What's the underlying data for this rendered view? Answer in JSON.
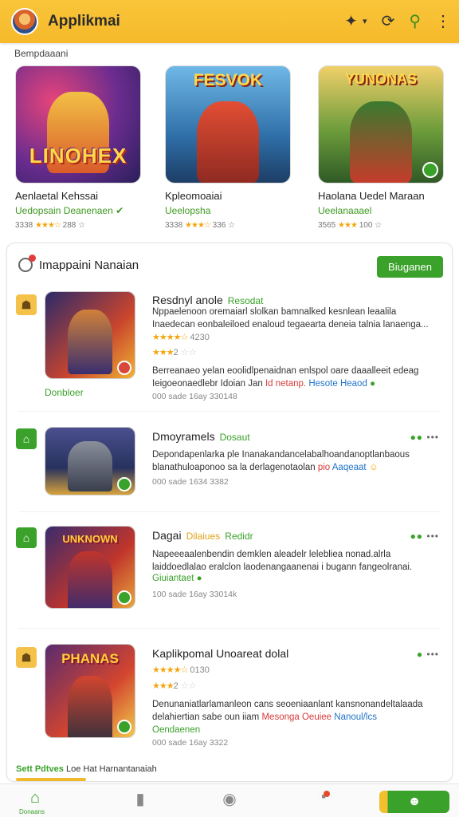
{
  "appbar": {
    "title": "Applikmai",
    "icons": [
      "bird-icon",
      "chevron-down-icon",
      "refresh-icon",
      "search-icon",
      "more-vertical-icon"
    ]
  },
  "featured": {
    "section_label": "Bempdaaani",
    "items": [
      {
        "logo_text": "LINOHEX",
        "top_text": "",
        "name": "Aenlaetal Kehssai",
        "sub": "Uedopsain Deanenaen",
        "rating": "3338",
        "rating_extra": "288",
        "colors": [
          "#3a1f6e",
          "#c63a7a",
          "#f0a623"
        ]
      },
      {
        "logo_text": "",
        "top_text": "FESVOK",
        "name": "Kpleomoaiai",
        "sub": "Ueelopsha",
        "rating": "3338",
        "rating_extra": "336",
        "colors": [
          "#2f6fa8",
          "#e24e33",
          "#f2b441"
        ]
      },
      {
        "logo_text": "",
        "top_text": "YUNONAS",
        "name": "Haolana Uedel Maraan",
        "sub": "Ueelanaaael",
        "rating": "3565",
        "rating_extra": "100",
        "colors": [
          "#3a6f2f",
          "#c53c2b",
          "#f5d24b"
        ]
      }
    ]
  },
  "panel": {
    "title": "Imappaini Nanaian",
    "button_label": "Biuganen",
    "rows": [
      {
        "title": "Resdnyl anole",
        "tag": "Resodat",
        "desc_lines": [
          "Nppaelenoon oremaiarl slolkan bamnalked kesnlean leaalila",
          "Inaedecan eonbaleiloed enaloud tegaearta deneia talnia lanaenga..."
        ],
        "rating_main": "4230",
        "rating_second": "2",
        "desc2_lines": [
          "Berreanaeo yelan eoolidlpenaidnan enlspol oare daaalleeit edeag",
          "Ieigoeonaedlebr Idoian Jan"
        ],
        "desc2_red": "Id netanp.",
        "desc2_blue": "Hesote Heaod",
        "meta": "000 sade 16ay  330148",
        "green_label": "Donbloer",
        "thumb_text": "",
        "badge": "person-icon",
        "badge_glyph": "☗",
        "colors": [
          "#2b2a6a",
          "#c9452e",
          "#f0b232"
        ]
      },
      {
        "title": "Dmoyramels",
        "tag": "Dosaut",
        "desc_lines": [
          "Depondapenlarka ple Inanakandancelabalhoandanoptlanbaous",
          "blanathuloaponoo sa la derlagenotaolan"
        ],
        "desc_red": "pio",
        "desc_blue": "Aaqeaat",
        "meta": "000 sade 1634  3382",
        "thumb_text": "",
        "badge": "home-icon",
        "badge_glyph": "⌂",
        "colors": [
          "#27325e",
          "#4b4f8e",
          "#d6a23c"
        ]
      },
      {
        "title": "Dagai",
        "tag": "Dilaiues",
        "tag2": "Redidr",
        "desc_lines": [
          "Napeeeaalenbendin demklen aleadelr lelebliea nonad.alrla",
          "laiddoedlalao eralclon laodenangaanenai i bugann fangeolranai."
        ],
        "green_label_inline": "Giuiantaet",
        "meta": "100 sade 16ay  33014k",
        "thumb_text": "UNKNOWN",
        "badge": "home-icon",
        "badge_glyph": "⌂",
        "colors": [
          "#3a2b6e",
          "#c0352c",
          "#e7a63a"
        ]
      },
      {
        "title": "Kaplikpomal Unoareat dolal",
        "tag": "",
        "rating_main": "0130",
        "rating_second": "2",
        "desc_lines": [
          "Denunaniatlarlamanleon cans seoeniaanlant kansnonandeltalaada",
          "delahiertian sabe oun iiam"
        ],
        "desc_red": "Mesonga Oeuiee",
        "desc_blue": "Nanoul/lcs",
        "green_label_inline": "Oendaenen",
        "meta": "000 sade 16ay  3322",
        "thumb_text": "PHANAS",
        "badge": "person-icon",
        "badge_glyph": "☗",
        "colors": [
          "#5a2b6e",
          "#d3452f",
          "#f1c94b"
        ]
      }
    ]
  },
  "footer_note": {
    "green": "Sett Pdtves",
    "text": "Loe Hat Harnantanaiah"
  },
  "bottomnav": {
    "home_label": "Donaans",
    "items": [
      "home-icon",
      "bookmark-icon",
      "compass-icon",
      "bell-icon",
      "profile-icon"
    ]
  }
}
